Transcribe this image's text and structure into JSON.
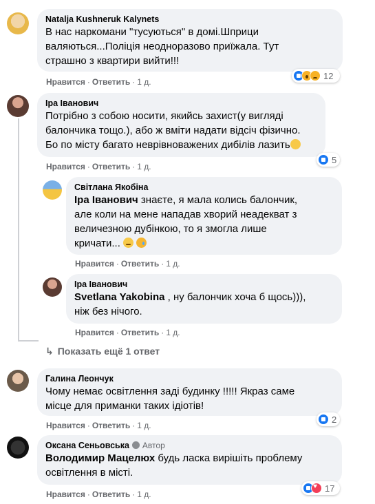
{
  "comments": [
    {
      "author": "Natalja Kushneruk Kalynets",
      "lines": [
        "В нас наркомани \"тусуються\" в домі.Шприци",
        "валяються...Поліція неодноразово приїжала. Тут",
        "страшно з квартири вийти!!!"
      ],
      "like_label": "Нравится",
      "reply_label": "Ответить",
      "time": "1 д.",
      "reactions": [
        "like",
        "wow",
        "sad"
      ],
      "reaction_count": "12"
    },
    {
      "author": "Іра Іванович",
      "lines": [
        "Потрібно з собою носити, якийсь захист(у вигляді",
        "балончика тощо.), або ж вміти надати відсіч фізично.",
        "Бо по місту багато неврівноважених дибілів лазить"
      ],
      "like_label": "Нравится",
      "reply_label": "Ответить",
      "time": "1 д.",
      "reactions": [
        "like"
      ],
      "reaction_count": "5"
    },
    {
      "author": "Світлана Якобіна",
      "mention": "Іра Іванович",
      "lines": [
        " знаєте, я мала колись балончик,",
        "але коли на мене нападав хворий неадекват з",
        "величезною дубінкою, то я змогла лише",
        "кричати... "
      ],
      "like_label": "Нравится",
      "reply_label": "Ответить",
      "time": "1 д."
    },
    {
      "author": "Іра Іванович",
      "mention": "Svetlana Yakobina",
      "lines": [
        " , ну балончик хоча б щось))),",
        "ніж без нічого."
      ],
      "like_label": "Нравится",
      "reply_label": "Ответить",
      "time": "1 д."
    },
    {
      "author": "Галина Леончук",
      "lines": [
        "Чому немає освітлення заді будинку !!!!! Якраз саме",
        "місце для приманки таких ідіотів!"
      ],
      "like_label": "Нравится",
      "reply_label": "Ответить",
      "time": "1 д.",
      "reactions": [
        "like"
      ],
      "reaction_count": "2"
    },
    {
      "author": "Оксана Сеньовська",
      "author_tag": "Автор",
      "mention": "Володимир Мацелюх",
      "lines": [
        " будь ласка вирішіть проблему",
        "освітлення в місті."
      ],
      "like_label": "Нравится",
      "reply_label": "Ответить",
      "time": "1 д.",
      "reactions": [
        "like",
        "love"
      ],
      "reaction_count": "17"
    }
  ],
  "more_replies": "Показать ещё 1 ответ",
  "colors": {
    "bubble": "#f0f2f5",
    "meta": "#65676b",
    "like_blue": "#1877f2"
  }
}
